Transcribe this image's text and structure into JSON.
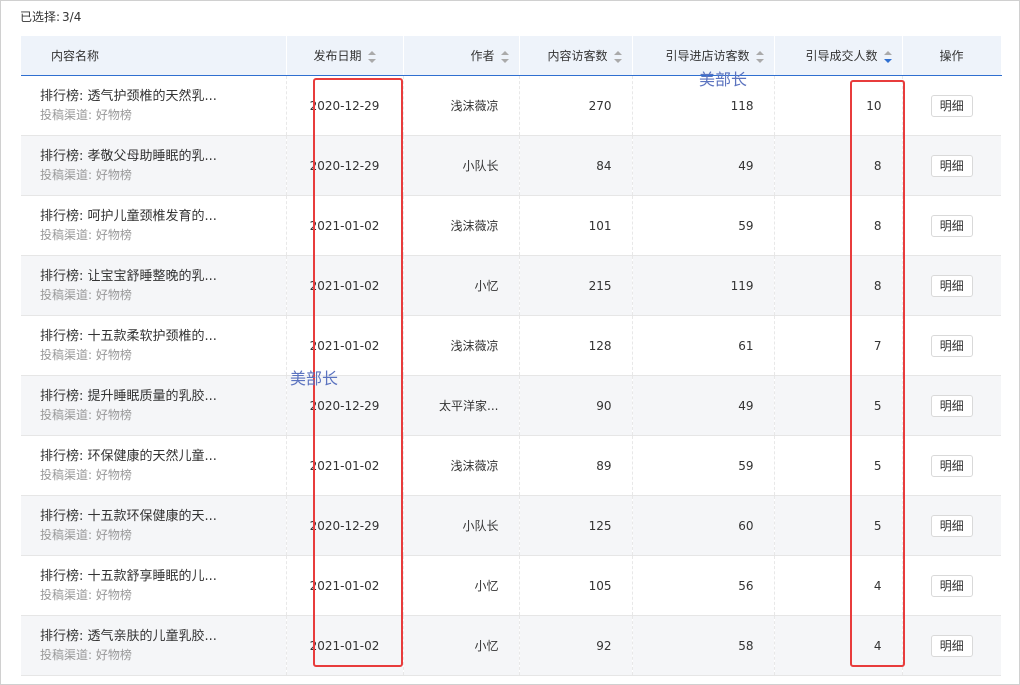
{
  "selection": {
    "label": "已选择:",
    "value": "3/4"
  },
  "columns": {
    "name": "内容名称",
    "date": "发布日期",
    "author": "作者",
    "visitors": "内容访客数",
    "store_visitors": "引导进店访客数",
    "deals": "引导成交人数",
    "action": "操作"
  },
  "rows": [
    {
      "title": "排行榜: 透气护颈椎的天然乳...",
      "channel": "投稿渠道: 好物榜",
      "date": "2020-12-29",
      "author": "浅沫薇凉",
      "visitors": "270",
      "store_visitors": "118",
      "deals": "10",
      "action": "明细"
    },
    {
      "title": "排行榜: 孝敬父母助睡眠的乳...",
      "channel": "投稿渠道: 好物榜",
      "date": "2020-12-29",
      "author": "小队长",
      "visitors": "84",
      "store_visitors": "49",
      "deals": "8",
      "action": "明细"
    },
    {
      "title": "排行榜: 呵护儿童颈椎发育的...",
      "channel": "投稿渠道: 好物榜",
      "date": "2021-01-02",
      "author": "浅沫薇凉",
      "visitors": "101",
      "store_visitors": "59",
      "deals": "8",
      "action": "明细"
    },
    {
      "title": "排行榜: 让宝宝舒睡整晚的乳...",
      "channel": "投稿渠道: 好物榜",
      "date": "2021-01-02",
      "author": "小忆",
      "visitors": "215",
      "store_visitors": "119",
      "deals": "8",
      "action": "明细"
    },
    {
      "title": "排行榜: 十五款柔软护颈椎的...",
      "channel": "投稿渠道: 好物榜",
      "date": "2021-01-02",
      "author": "浅沫薇凉",
      "visitors": "128",
      "store_visitors": "61",
      "deals": "7",
      "action": "明细"
    },
    {
      "title": "排行榜: 提升睡眠质量的乳胶...",
      "channel": "投稿渠道: 好物榜",
      "date": "2020-12-29",
      "author": "太平洋家...",
      "visitors": "90",
      "store_visitors": "49",
      "deals": "5",
      "action": "明细"
    },
    {
      "title": "排行榜: 环保健康的天然儿童...",
      "channel": "投稿渠道: 好物榜",
      "date": "2021-01-02",
      "author": "浅沫薇凉",
      "visitors": "89",
      "store_visitors": "59",
      "deals": "5",
      "action": "明细"
    },
    {
      "title": "排行榜: 十五款环保健康的天...",
      "channel": "投稿渠道: 好物榜",
      "date": "2020-12-29",
      "author": "小队长",
      "visitors": "125",
      "store_visitors": "60",
      "deals": "5",
      "action": "明细"
    },
    {
      "title": "排行榜: 十五款舒享睡眠的儿...",
      "channel": "投稿渠道: 好物榜",
      "date": "2021-01-02",
      "author": "小忆",
      "visitors": "105",
      "store_visitors": "56",
      "deals": "4",
      "action": "明细"
    },
    {
      "title": "排行榜: 透气亲肤的儿童乳胶...",
      "channel": "投稿渠道: 好物榜",
      "date": "2021-01-02",
      "author": "小忆",
      "visitors": "92",
      "store_visitors": "58",
      "deals": "4",
      "action": "明细"
    }
  ],
  "watermarks": [
    "美部长",
    "美部长"
  ]
}
